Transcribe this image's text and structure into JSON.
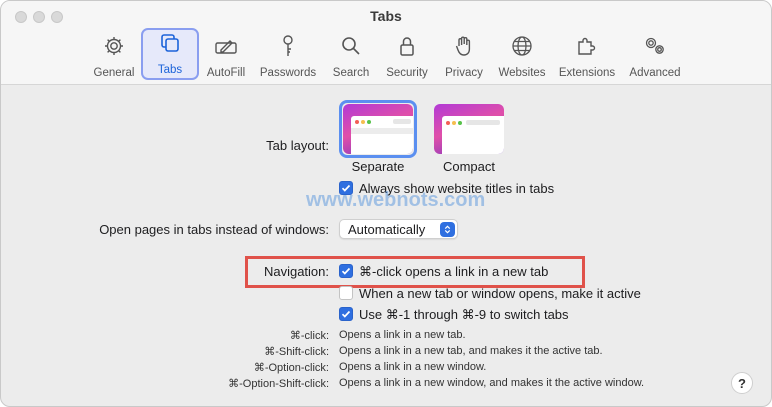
{
  "window": {
    "title": "Tabs"
  },
  "toolbar": {
    "tabs": [
      {
        "id": "general",
        "label": "General",
        "icon": "gear-icon"
      },
      {
        "id": "tabs",
        "label": "Tabs",
        "icon": "tabs-icon",
        "active": true
      },
      {
        "id": "autofill",
        "label": "AutoFill",
        "icon": "pen-field-icon"
      },
      {
        "id": "passwords",
        "label": "Passwords",
        "icon": "key-icon"
      },
      {
        "id": "search",
        "label": "Search",
        "icon": "magnifier-icon"
      },
      {
        "id": "security",
        "label": "Security",
        "icon": "lock-icon"
      },
      {
        "id": "privacy",
        "label": "Privacy",
        "icon": "hand-icon"
      },
      {
        "id": "websites",
        "label": "Websites",
        "icon": "globe-icon"
      },
      {
        "id": "extensions",
        "label": "Extensions",
        "icon": "puzzle-icon"
      },
      {
        "id": "advanced",
        "label": "Advanced",
        "icon": "gears-icon"
      }
    ]
  },
  "tab_layout": {
    "label": "Tab layout:",
    "options": [
      {
        "label": "Separate",
        "selected": true
      },
      {
        "label": "Compact",
        "selected": false
      }
    ],
    "always_show_titles": {
      "label": "Always show website titles in tabs",
      "checked": true
    }
  },
  "open_pages": {
    "label": "Open pages in tabs instead of windows:",
    "value": "Automatically"
  },
  "watermark": "www.webnots.com",
  "navigation": {
    "label": "Navigation:",
    "options": [
      {
        "label": "⌘-click opens a link in a new tab",
        "checked": true
      },
      {
        "label": "When a new tab or window opens, make it active",
        "checked": false
      },
      {
        "label": "Use ⌘-1 through ⌘-9 to switch tabs",
        "checked": true
      }
    ]
  },
  "shortcuts": [
    {
      "key": "⌘-click:",
      "desc": "Opens a link in a new tab."
    },
    {
      "key": "⌘-Shift-click:",
      "desc": "Opens a link in a new tab, and makes it the active tab."
    },
    {
      "key": "⌘-Option-click:",
      "desc": "Opens a link in a new window."
    },
    {
      "key": "⌘-Option-Shift-click:",
      "desc": "Opens a link in a new window, and makes it the active window."
    }
  ],
  "help": "?",
  "colors": {
    "accent": "#2f6fe0",
    "highlight": "#e0524a"
  }
}
